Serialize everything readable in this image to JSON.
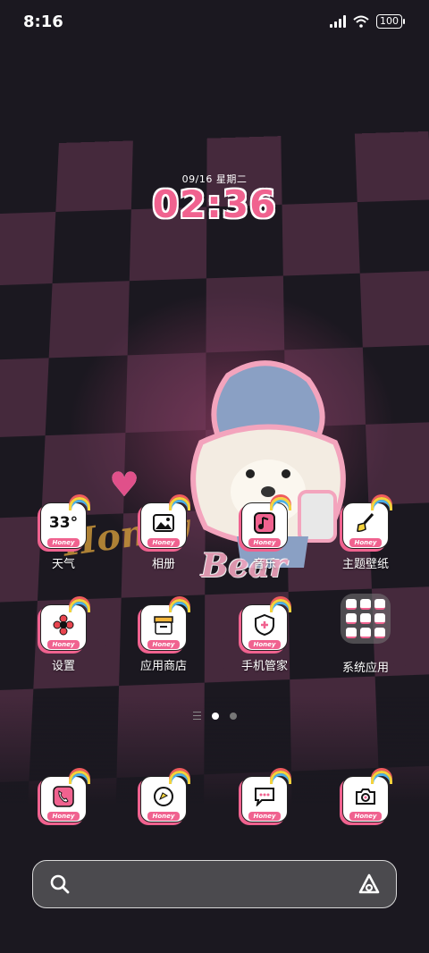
{
  "status_bar": {
    "time": "8:16",
    "battery": "100"
  },
  "clock_widget": {
    "date": "09/16  星期二",
    "time": "02:36"
  },
  "wallpaper": {
    "text_1": "Honey",
    "text_2": "Bear"
  },
  "icon_badge": "Honey",
  "apps": [
    {
      "label": "天气",
      "icon": "weather-icon",
      "temp": "33°"
    },
    {
      "label": "相册",
      "icon": "gallery-icon"
    },
    {
      "label": "音乐",
      "icon": "music-icon"
    },
    {
      "label": "主题壁纸",
      "icon": "theme-brush-icon"
    },
    {
      "label": "设置",
      "icon": "settings-flower-icon"
    },
    {
      "label": "应用商店",
      "icon": "app-store-icon"
    },
    {
      "label": "手机管家",
      "icon": "security-shield-icon"
    },
    {
      "label": "系统应用",
      "icon": "folder-icon"
    }
  ],
  "dock": [
    {
      "icon": "phone-icon"
    },
    {
      "icon": "browser-icon"
    },
    {
      "icon": "messages-icon"
    },
    {
      "icon": "camera-icon"
    }
  ],
  "page_indicator": {
    "pages": 2,
    "active": 1
  },
  "colors": {
    "accent": "#f0628f",
    "background": "#1b1820"
  }
}
